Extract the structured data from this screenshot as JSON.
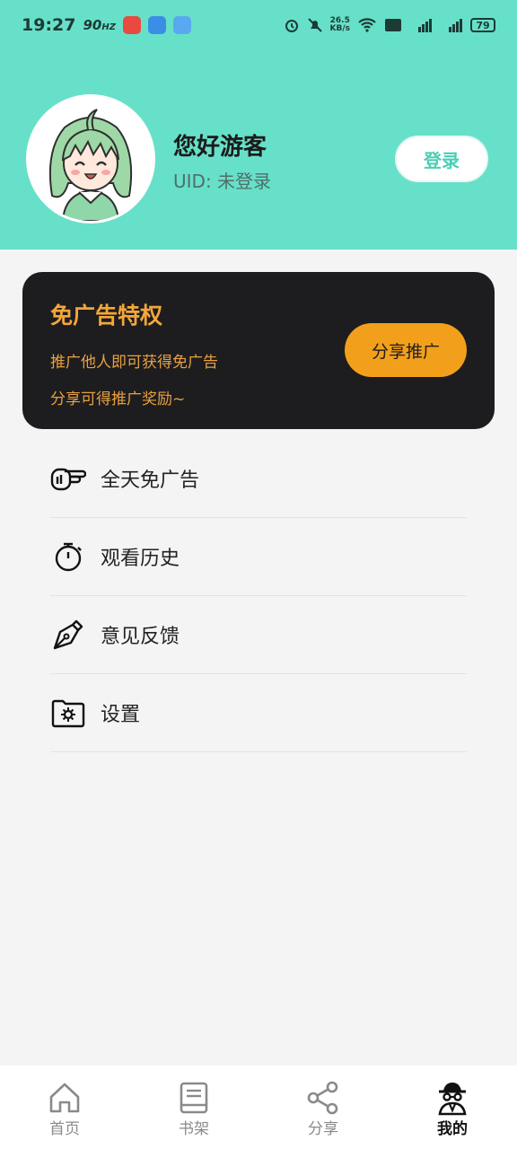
{
  "status_bar": {
    "time": "19:27",
    "refresh_rate": "90",
    "refresh_unit": "HZ",
    "net_speed_value": "26.5",
    "net_speed_unit": "KB/s",
    "battery": "79"
  },
  "header": {
    "bg_color": "#67e0c9",
    "greeting": "您好游客",
    "uid_text": "UID: 未登录",
    "login_label": "登录"
  },
  "promo": {
    "title": "免广告特权",
    "line1": "推广他人即可获得免广告",
    "line2": "分享可得推广奖励~",
    "button_label": "分享推广",
    "accent_color": "#f2a01b"
  },
  "menu": {
    "items": [
      {
        "label": "全天免广告",
        "icon": "pointing-hand-icon"
      },
      {
        "label": "观看历史",
        "icon": "stopwatch-icon"
      },
      {
        "label": "意见反馈",
        "icon": "pen-nib-icon"
      },
      {
        "label": "设置",
        "icon": "folder-gear-icon"
      }
    ]
  },
  "tabbar": {
    "tabs": [
      {
        "label": "首页",
        "icon": "home-icon"
      },
      {
        "label": "书架",
        "icon": "book-icon"
      },
      {
        "label": "分享",
        "icon": "share-icon"
      },
      {
        "label": "我的",
        "icon": "incognito-user-icon",
        "active": true
      }
    ]
  }
}
